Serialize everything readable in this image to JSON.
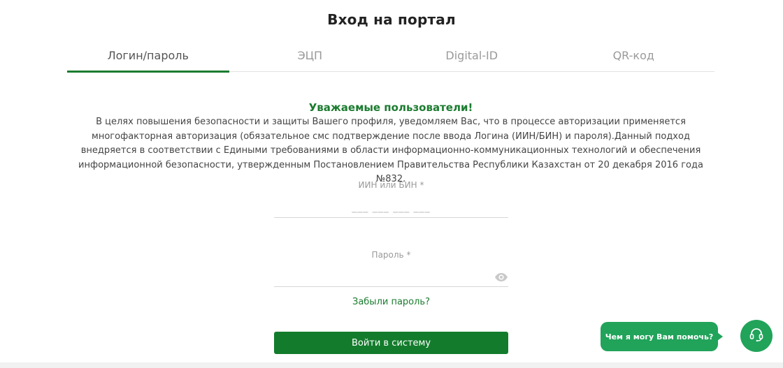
{
  "page": {
    "title": "Вход на портал"
  },
  "tabs": [
    {
      "label": "Логин/пароль",
      "active": true
    },
    {
      "label": "ЭЦП",
      "active": false
    },
    {
      "label": "Digital-ID",
      "active": false
    },
    {
      "label": "QR-код",
      "active": false
    }
  ],
  "notice": {
    "title": "Уважаемые пользователи!",
    "text": "В целях повышения безопасности и защиты Вашего профиля, уведомляем Вас, что в процессе авторизации применяется многофакторная авторизация (обязательное смс подтверждение после ввода Логина (ИИН/БИН) и пароля).Данный подход внедряется в соответствии с Едиными требованиями в области информационно-коммуникационных технологий и обеспечения информационной безопасности, утвержденным Постановлением Правительства Республики Казахстан от 20 декабря 2016 года №832."
  },
  "form": {
    "iin_label": "ИИН или БИН *",
    "iin_placeholder": "___ ___ ___ ___",
    "iin_value": "",
    "password_label": "Пароль *",
    "password_placeholder": "",
    "password_value": "",
    "forgot_password": "Забыли пароль?",
    "submit_label": "Войти в систему"
  },
  "chat": {
    "prompt": "Чем я могу Вам помочь?"
  },
  "icons": {
    "show_password": "eye-icon",
    "support": "headset-icon"
  },
  "colors": {
    "accent": "#1b7c2f",
    "button": "#137c2c",
    "chat": "#21a35a"
  }
}
